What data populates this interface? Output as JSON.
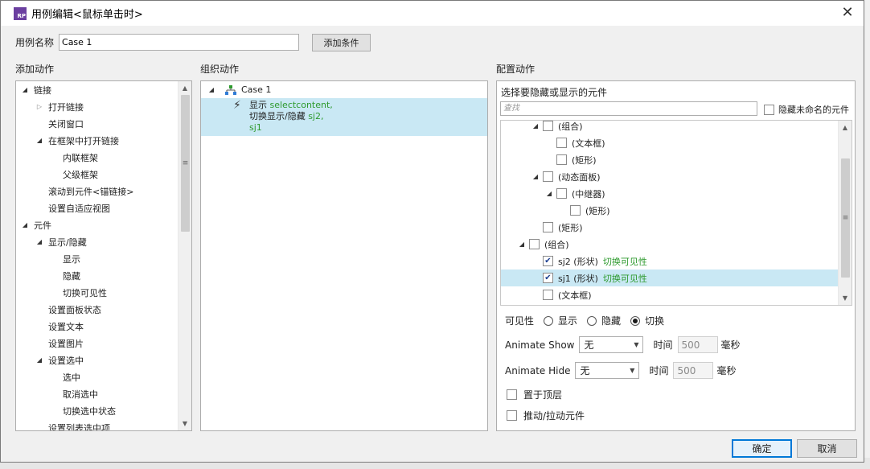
{
  "dialog": {
    "title": "用例编辑<鼠标单击时>",
    "icon_text": "RP",
    "close": "✕"
  },
  "case_name": {
    "label": "用例名称",
    "value": "Case 1"
  },
  "add_condition_label": "添加条件",
  "sections": {
    "add_action": "添加动作",
    "organize_action": "组织动作",
    "configure_action": "配置动作"
  },
  "add_action_tree": [
    {
      "label": "链接",
      "indent": 0,
      "tri": "open"
    },
    {
      "label": "打开链接",
      "indent": 1,
      "tri": "closed"
    },
    {
      "label": "关闭窗口",
      "indent": 1,
      "tri": ""
    },
    {
      "label": "在框架中打开链接",
      "indent": 1,
      "tri": "open"
    },
    {
      "label": "内联框架",
      "indent": 2,
      "tri": ""
    },
    {
      "label": "父级框架",
      "indent": 2,
      "tri": ""
    },
    {
      "label": "滚动到元件<锚链接>",
      "indent": 1,
      "tri": ""
    },
    {
      "label": "设置自适应视图",
      "indent": 1,
      "tri": ""
    },
    {
      "label": "元件",
      "indent": 0,
      "tri": "open"
    },
    {
      "label": "显示/隐藏",
      "indent": 1,
      "tri": "open"
    },
    {
      "label": "显示",
      "indent": 2,
      "tri": ""
    },
    {
      "label": "隐藏",
      "indent": 2,
      "tri": ""
    },
    {
      "label": "切换可见性",
      "indent": 2,
      "tri": ""
    },
    {
      "label": "设置面板状态",
      "indent": 1,
      "tri": ""
    },
    {
      "label": "设置文本",
      "indent": 1,
      "tri": ""
    },
    {
      "label": "设置图片",
      "indent": 1,
      "tri": ""
    },
    {
      "label": "设置选中",
      "indent": 1,
      "tri": "open"
    },
    {
      "label": "选中",
      "indent": 2,
      "tri": ""
    },
    {
      "label": "取消选中",
      "indent": 2,
      "tri": ""
    },
    {
      "label": "切换选中状态",
      "indent": 2,
      "tri": ""
    },
    {
      "label": "设置列表选中项",
      "indent": 1,
      "tri": ""
    }
  ],
  "organize": {
    "case_label": "Case 1",
    "action": {
      "prefix1": "显示 ",
      "target1": "selectcontent,",
      "prefix2": "切换显示/隐藏 ",
      "target2": "sj2,",
      "line3": "sj1"
    }
  },
  "configure": {
    "title": "选择要隐藏或显示的元件",
    "search_placeholder": "查找",
    "hide_unnamed_label": "隐藏未命名的元件",
    "elements": [
      {
        "label": "(组合)",
        "indent": 2,
        "tri": "open",
        "checked": false,
        "action": "",
        "selected": false
      },
      {
        "label": "(文本框)",
        "indent": 3,
        "tri": "",
        "checked": false,
        "action": "",
        "selected": false
      },
      {
        "label": "(矩形)",
        "indent": 3,
        "tri": "",
        "checked": false,
        "action": "",
        "selected": false
      },
      {
        "label": "(动态面板)",
        "indent": 2,
        "tri": "open",
        "checked": false,
        "action": "",
        "selected": false
      },
      {
        "label": "(中继器)",
        "indent": 3,
        "tri": "open",
        "checked": false,
        "action": "",
        "selected": false
      },
      {
        "label": "(矩形)",
        "indent": 4,
        "tri": "",
        "checked": false,
        "action": "",
        "selected": false
      },
      {
        "label": "(矩形)",
        "indent": 2,
        "tri": "",
        "checked": false,
        "action": "",
        "selected": false
      },
      {
        "label": "(组合)",
        "indent": 1,
        "tri": "open",
        "checked": false,
        "action": "",
        "selected": false
      },
      {
        "label": "sj2 (形状)",
        "indent": 2,
        "tri": "",
        "checked": true,
        "action": "切换可见性",
        "selected": false
      },
      {
        "label": "sj1 (形状)",
        "indent": 2,
        "tri": "",
        "checked": true,
        "action": "切换可见性",
        "selected": true
      },
      {
        "label": "(文本框)",
        "indent": 2,
        "tri": "",
        "checked": false,
        "action": "",
        "selected": false
      }
    ],
    "visibility": {
      "label": "可见性",
      "options": [
        "显示",
        "隐藏",
        "切换"
      ],
      "selected": "切换"
    },
    "animate_show": {
      "label": "Animate Show",
      "value": "无",
      "time_label": "时间",
      "time_value": "500",
      "unit": "毫秒"
    },
    "animate_hide": {
      "label": "Animate Hide",
      "value": "无",
      "time_label": "时间",
      "time_value": "500",
      "unit": "毫秒"
    },
    "bring_to_front_label": "置于顶层",
    "push_pull_label": "推动/拉动元件"
  },
  "buttons": {
    "ok": "确定",
    "cancel": "取消"
  }
}
